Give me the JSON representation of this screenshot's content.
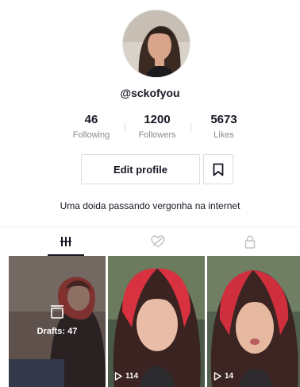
{
  "profile": {
    "username": "@sckofyou",
    "bio": "Uma doida passando vergonha na internet"
  },
  "stats": [
    {
      "value": "46",
      "label": "Following"
    },
    {
      "value": "1200",
      "label": "Followers"
    },
    {
      "value": "5673",
      "label": "Likes"
    }
  ],
  "actions": {
    "edit_profile_label": "Edit profile"
  },
  "tabs": [
    {
      "name": "videos",
      "icon": "grid-icon",
      "selected": true
    },
    {
      "name": "liked",
      "icon": "heart-hidden-icon",
      "selected": false
    },
    {
      "name": "private",
      "icon": "lock-icon",
      "selected": false
    }
  ],
  "videos": [
    {
      "type": "drafts",
      "drafts_label": "Drafts: 47"
    },
    {
      "type": "video",
      "views": "114"
    },
    {
      "type": "video",
      "views": "14"
    }
  ],
  "colors": {
    "text": "#161823",
    "secondary": "#8a8b91",
    "border": "#dcdcdf"
  }
}
